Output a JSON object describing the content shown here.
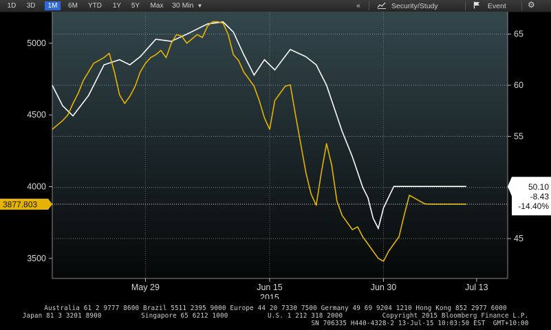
{
  "toolbar": {
    "periods": [
      "1D",
      "3D",
      "1M",
      "6M",
      "YTD",
      "1Y",
      "5Y",
      "Max"
    ],
    "active_period": "1M",
    "interval": "30 Min",
    "interval_arrow": "▼",
    "collapse_label": "«",
    "security_study_label": "Security/Study",
    "event_label": "Event",
    "icons": [
      "chart-line-icon",
      "flag-icon",
      "gear-icon"
    ]
  },
  "colors": {
    "background": "#000000",
    "price_series": "#e6b400",
    "indicator_series": "#ffffff",
    "price_tag_bg": "#e6b400",
    "active_tab": "#2f6bd8"
  },
  "chart_data": {
    "type": "line",
    "x_tick_labels": [
      "May 29",
      "Jun 15",
      "Jun 30",
      "Jul 13"
    ],
    "year_label": "2015",
    "left_axis": {
      "ticks": [
        3500,
        4000,
        4500,
        5000
      ],
      "range": [
        3360,
        5220
      ]
    },
    "right_axis": {
      "ticks": [
        45,
        50,
        55,
        60,
        65
      ],
      "range": [
        41.1,
        67.2
      ]
    },
    "series": [
      {
        "axis": "left",
        "color": "#e6b400",
        "x": [
          0,
          1,
          2,
          3,
          4,
          5,
          6,
          7,
          8,
          9,
          10,
          11,
          12,
          13,
          14,
          15,
          16,
          17,
          18,
          19,
          20,
          21,
          22,
          23,
          24,
          25,
          26,
          27,
          28,
          29,
          30,
          31,
          32,
          33,
          34,
          35,
          36,
          37,
          38,
          39,
          40,
          41,
          42,
          43,
          44,
          45,
          46,
          47,
          48,
          49,
          50,
          51,
          52,
          53,
          54,
          55,
          56,
          57,
          58,
          59,
          60,
          61,
          62,
          63,
          64,
          65,
          66,
          67,
          68,
          69,
          70,
          71,
          72,
          73,
          74,
          75,
          76,
          77,
          78,
          79,
          80
        ],
        "values": [
          4400,
          4430,
          4460,
          4500,
          4580,
          4650,
          4740,
          4800,
          4860,
          4880,
          4900,
          4930,
          4800,
          4640,
          4580,
          4630,
          4700,
          4800,
          4860,
          4900,
          4920,
          4950,
          4900,
          5000,
          5060,
          5050,
          5000,
          5030,
          5060,
          5040,
          5120,
          5150,
          5150,
          5140,
          5060,
          4920,
          4880,
          4800,
          4750,
          4700,
          4600,
          4480,
          4400,
          4600,
          4650,
          4700,
          4710,
          4500,
          4300,
          4100,
          3950,
          3870,
          4100,
          4300,
          4150,
          3900,
          3800,
          3750,
          3700,
          3720,
          3650,
          3600,
          3550,
          3500,
          3480,
          3550,
          3600,
          3650,
          3800,
          3940,
          3920,
          3900,
          3880,
          3878,
          3878,
          3878,
          3878,
          3878,
          3878,
          3878,
          3878
        ]
      },
      {
        "axis": "right",
        "color": "#ffffff",
        "points": [
          [
            0,
            60
          ],
          [
            2,
            58
          ],
          [
            4,
            57
          ],
          [
            7,
            59
          ],
          [
            10,
            62
          ],
          [
            13,
            62.5
          ],
          [
            15,
            62
          ],
          [
            17,
            62.8
          ],
          [
            20,
            64.5
          ],
          [
            23,
            64.3
          ],
          [
            26,
            65
          ],
          [
            30,
            66
          ],
          [
            33,
            66.2
          ],
          [
            35,
            65.2
          ],
          [
            37,
            63
          ],
          [
            39,
            61
          ],
          [
            41,
            62.5
          ],
          [
            43,
            61.5
          ],
          [
            46,
            63.5
          ],
          [
            49,
            62.8
          ],
          [
            51,
            62
          ],
          [
            53,
            60
          ],
          [
            56,
            55.5
          ],
          [
            58,
            53
          ],
          [
            60,
            50
          ],
          [
            61,
            49
          ],
          [
            62,
            47
          ],
          [
            63,
            46
          ],
          [
            64,
            48
          ],
          [
            66,
            50.1
          ],
          [
            80,
            50.1
          ]
        ]
      }
    ],
    "current_price_label": "3877.803",
    "right_tag_lines": [
      "50.10",
      "-8.43",
      "-14.40%"
    ]
  },
  "footer": {
    "line1": "Australia 61 2 9777 8600 Brazil 5511 2395 9000 Europe 44 20 7330 7500 Germany 49 69 9204 1210 Hong Kong 852 2977 6000",
    "line2": "Japan 81 3 3201 8900          Singapore 65 6212 1000          U.S. 1 212 318 2000          Copyright 2015 Bloomberg Finance L.P.",
    "line3": "SN 706335 H440-4328-2 13-Jul-15 10:03:50 EST  GMT+10:00"
  }
}
